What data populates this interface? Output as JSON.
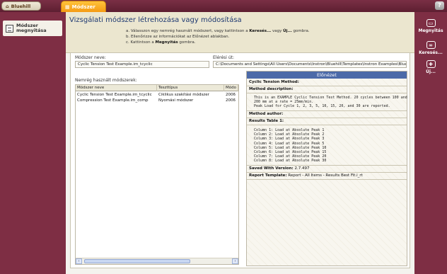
{
  "topbar": {
    "home_label": "Bluehill",
    "active_tab": "Módszer",
    "help_label": "?"
  },
  "left_nav": {
    "item_label_line1": "Módszer",
    "item_label_line2": "megnyitása"
  },
  "right_nav": [
    {
      "label": "Megnyitás",
      "icon": "folder-open-icon"
    },
    {
      "label": "Keresés...",
      "icon": "search-icon"
    },
    {
      "label": "Új...",
      "icon": "new-icon"
    }
  ],
  "header": {
    "title": "Vizsgálati módszer létrehozása vagy módosítása",
    "instr_a_pre": "a. Válasszon egy nemrég használt módszert, vagy kattintson a ",
    "instr_a_b1": "Keresés...",
    "instr_a_mid": " vagy ",
    "instr_a_b2": "Új...",
    "instr_a_post": " gombra.",
    "instr_b": "b. Ellenőrizze az információkat az Előnézet ablakban.",
    "instr_c_pre": "c. Kattintson a ",
    "instr_c_b": "Megnyitás",
    "instr_c_post": " gombra."
  },
  "form": {
    "method_name_label": "Módszer neve:",
    "method_name_value": "Cyclic Tension Test Example.im_tcyclic",
    "path_label": "Elérési út:",
    "path_value": "C:\\Documents and Settings\\All Users\\Documents\\Instron\\Bluehill\\Templates\\Instron Examples\\Bluehill Lite"
  },
  "recent": {
    "label": "Nemrég használt módszerek:",
    "columns": [
      "Módszer neve",
      "Teszttípus",
      "Módo"
    ],
    "rows": [
      [
        "Cyclic Tension Test Example.im_tcyclic",
        "Ciklikus szakítási módszer",
        "2006"
      ],
      [
        "Compression Test Example.im_comp",
        "Nyomási módszer",
        "2006"
      ]
    ]
  },
  "preview": {
    "title": "Előnézet",
    "method_heading": "Cyclic Tension Method:",
    "desc_heading": "Method description:",
    "desc_text": "This is an EXAMPLE Cyclic Tension Test Method. 20 cycles between 100 and\n200 mm at a rate = 25mm/min.\nPeak Load for Cycle 1, 2, 3, 5, 10, 15, 20, and 30 are reported.",
    "author_heading": "Method author:",
    "results_heading": "Results Table 1:",
    "results_text": "Column 1: Load at Absolute Peak 1\nColumn 2: Load at Absolute Peak 2\nColumn 3: Load at Absolute Peak 3\nColumn 4: Load at Absolute Peak 5\nColumn 5: Load at Absolute Peak 10\nColumn 6: Load at Absolute Peak 15\nColumn 7: Load at Absolute Peak 20\nColumn 8: Load at Absolute Peak 30",
    "version_label": "Saved With Version:",
    "version_value": " 2.7.497",
    "template_label": "Report Template:",
    "template_value": " Report - All Items - Results Best Fit.i_rt"
  }
}
